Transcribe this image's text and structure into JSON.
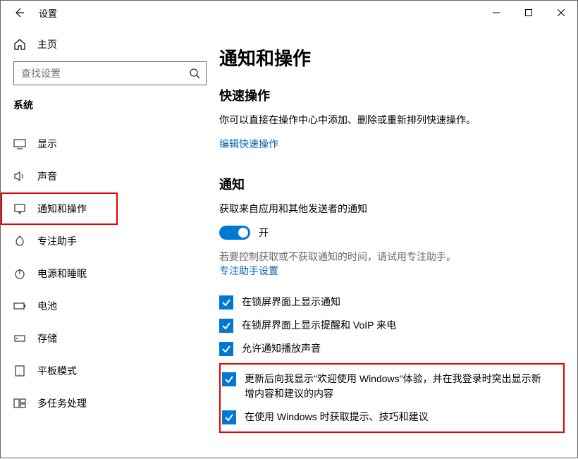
{
  "titlebar": {
    "title": "设置"
  },
  "sidebar": {
    "home_label": "主页",
    "search_placeholder": "查找设置",
    "section_label": "系统",
    "items": [
      {
        "label": "显示"
      },
      {
        "label": "声音"
      },
      {
        "label": "通知和操作"
      },
      {
        "label": "专注助手"
      },
      {
        "label": "电源和睡眠"
      },
      {
        "label": "电池"
      },
      {
        "label": "存储"
      },
      {
        "label": "平板模式"
      },
      {
        "label": "多任务处理"
      }
    ]
  },
  "main": {
    "page_title": "通知和操作",
    "quick_actions": {
      "heading": "快速操作",
      "description": "你可以直接在操作中心中添加、删除或重新排列快速操作。",
      "edit_link": "编辑快速操作"
    },
    "notifications": {
      "heading": "通知",
      "from_apps_label": "获取来自应用和其他发送者的通知",
      "toggle_on_label": "开",
      "focus_hint": "若要控制获取或不获取通知的时间，请试用专注助手。",
      "focus_link": "专注助手设置",
      "checkboxes": [
        {
          "label": "在锁屏界面上显示通知"
        },
        {
          "label": "在锁屏界面上显示提醒和 VoIP 来电"
        },
        {
          "label": "允许通知播放声音"
        },
        {
          "label": "更新后向我显示\"欢迎使用 Windows\"体验，并在我登录时突出显示新增内容和建议的内容"
        },
        {
          "label": "在使用 Windows 时获取提示、技巧和建议"
        }
      ]
    }
  }
}
